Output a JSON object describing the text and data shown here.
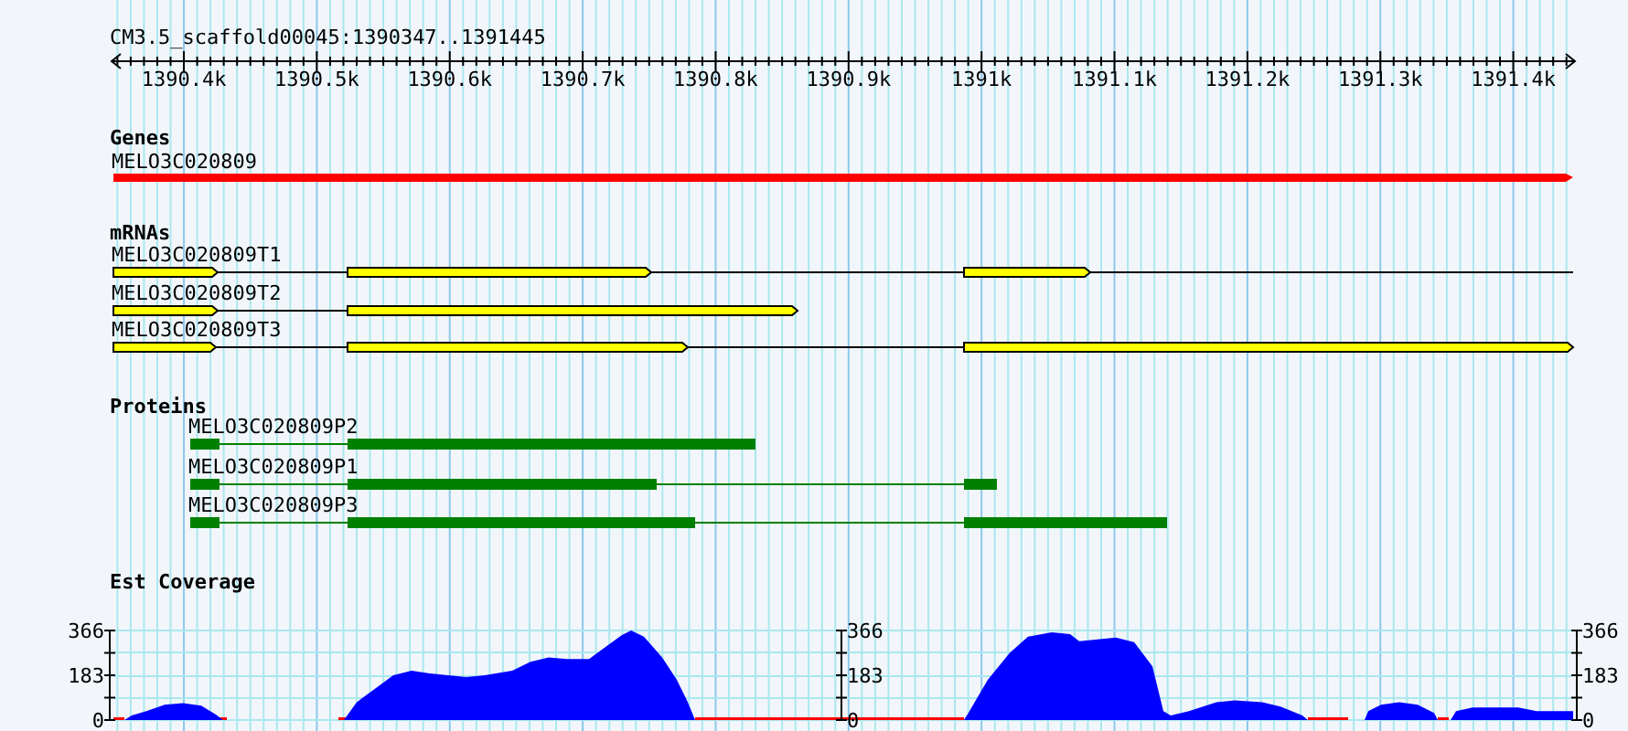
{
  "ruler": {
    "title": "CM3.5_scaffold00045:1390347..1391445",
    "ticks": [
      "1390.4k",
      "1390.5k",
      "1390.6k",
      "1390.7k",
      "1390.8k",
      "1390.9k",
      "1391k",
      "1391.1k",
      "1391.2k",
      "1391.3k",
      "1391.4k"
    ]
  },
  "tracks": [
    {
      "kind": "genes",
      "title": "Genes",
      "features": [
        {
          "name": "MELO3C020809"
        }
      ]
    },
    {
      "kind": "mrnas",
      "title": "mRNAs",
      "features": [
        {
          "name": "MELO3C020809T1"
        },
        {
          "name": "MELO3C020809T2"
        },
        {
          "name": "MELO3C020809T3"
        }
      ]
    },
    {
      "kind": "proteins",
      "title": "Proteins",
      "features": [
        {
          "name": "MELO3C020809P2"
        },
        {
          "name": "MELO3C020809P1"
        },
        {
          "name": "MELO3C020809P3"
        }
      ]
    },
    {
      "kind": "coverage",
      "title": "Est Coverage",
      "axes": [
        {
          "labels": [
            "366",
            "183",
            "0"
          ]
        },
        {
          "labels": [
            "366",
            "183",
            "0"
          ]
        },
        {
          "labels": [
            "366",
            "183",
            "0"
          ]
        }
      ]
    }
  ]
}
